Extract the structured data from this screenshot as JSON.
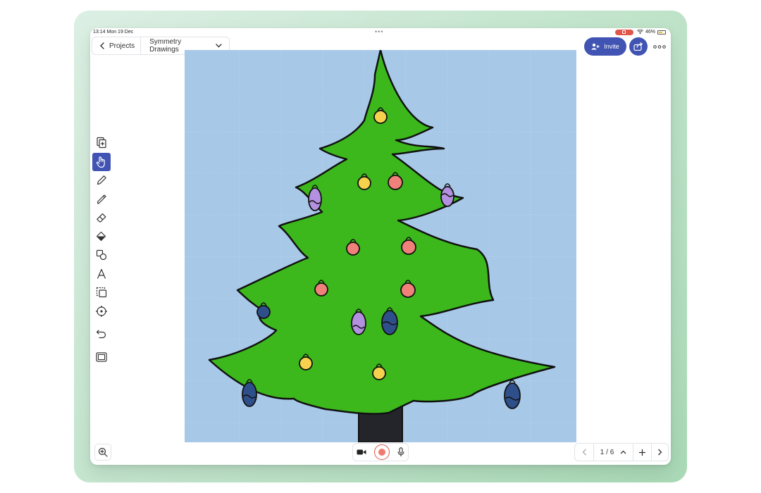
{
  "status": {
    "time": "13:14",
    "date": "Mon 19 Dec",
    "battery": "46%"
  },
  "header": {
    "back_label": "Projects",
    "project_title": "Symmetry Drawings",
    "invite_label": "Invite"
  },
  "pager": {
    "page_indicator": "1 / 6"
  },
  "toolbar": {
    "tools": [
      "add-page-icon",
      "hand-icon",
      "pencil-icon",
      "marker-icon",
      "eraser-icon",
      "fill-icon",
      "shapes-icon",
      "text-icon",
      "select-icon",
      "laser-icon",
      "undo-icon",
      "frame-icon"
    ],
    "active_tool": "hand-icon"
  },
  "colors": {
    "accent": "#4154b3",
    "canvas_background": "#a8c8e8",
    "tree_green": "#3cb81c",
    "trunk": "#24252b",
    "record": "#e0564a"
  }
}
